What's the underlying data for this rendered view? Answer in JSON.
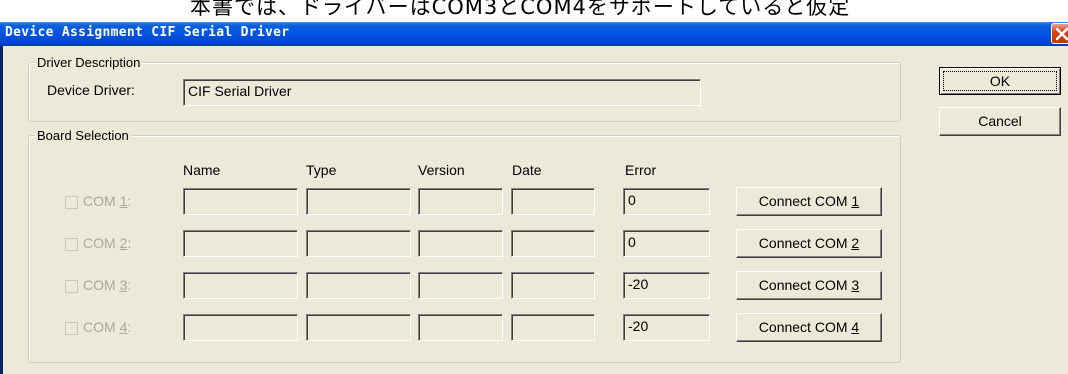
{
  "background_text": "本書では、ドライバーはCOM3とCOM4をサポートしていると仮定",
  "window": {
    "title": "Device Assignment CIF Serial Driver"
  },
  "driver_description": {
    "group_title": "Driver Description",
    "label": "Device Driver:",
    "value": "CIF Serial Driver"
  },
  "board_selection": {
    "group_title": "Board Selection",
    "columns": [
      "Name",
      "Type",
      "Version",
      "Date",
      "Error"
    ],
    "rows": [
      {
        "label": "COM ",
        "key": "1",
        "colon": ":",
        "name": "",
        "type": "",
        "version": "",
        "date": "",
        "error": "0",
        "button": "Connect COM ",
        "button_key": "1"
      },
      {
        "label": "COM ",
        "key": "2",
        "colon": ":",
        "name": "",
        "type": "",
        "version": "",
        "date": "",
        "error": "0",
        "button": "Connect COM ",
        "button_key": "2"
      },
      {
        "label": "COM ",
        "key": "3",
        "colon": ":",
        "name": "",
        "type": "",
        "version": "",
        "date": "",
        "error": "-20",
        "button": "Connect COM ",
        "button_key": "3"
      },
      {
        "label": "COM ",
        "key": "4",
        "colon": ":",
        "name": "",
        "type": "",
        "version": "",
        "date": "",
        "error": "-20",
        "button": "Connect COM ",
        "button_key": "4"
      }
    ]
  },
  "buttons": {
    "ok": "OK",
    "cancel": "Cancel"
  },
  "colors": {
    "titlebar": "#0054e3",
    "dialog_bg": "#ece9d8",
    "close": "#d8431b",
    "disabled_text": "#aca899"
  }
}
